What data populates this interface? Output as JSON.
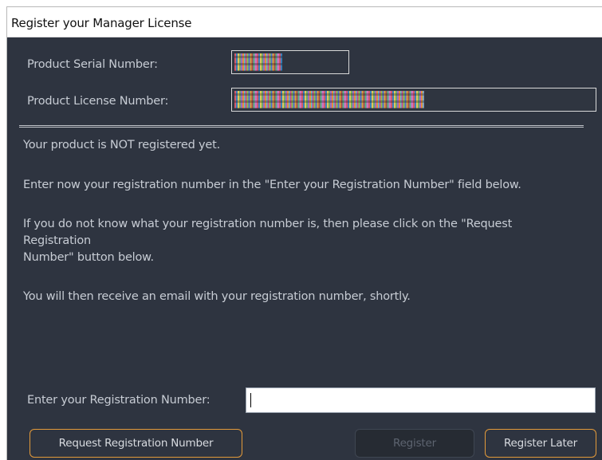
{
  "window": {
    "title": "Register your Manager License"
  },
  "fields": {
    "serial_label": "Product Serial Number:",
    "license_label": "Product License Number:"
  },
  "messages": {
    "line1": "Your product is NOT registered yet.",
    "line2": "Enter now your registration number in the \"Enter your Registration Number\" field below.",
    "line3a": "If you do not know what your registration number is, then please click on the \"Request",
    "line3b": "Registration",
    "line3c": "Number\" button below.",
    "line4": "You will then receive an email with your registration number, shortly."
  },
  "registration": {
    "label": "Enter your Registration Number:",
    "value": ""
  },
  "buttons": {
    "request": "Request Registration Number",
    "register": "Register",
    "register_later": "Register Later"
  },
  "colors": {
    "background": "#2e3440",
    "accent_border": "#e39a3a",
    "text": "#c7ccd4"
  }
}
